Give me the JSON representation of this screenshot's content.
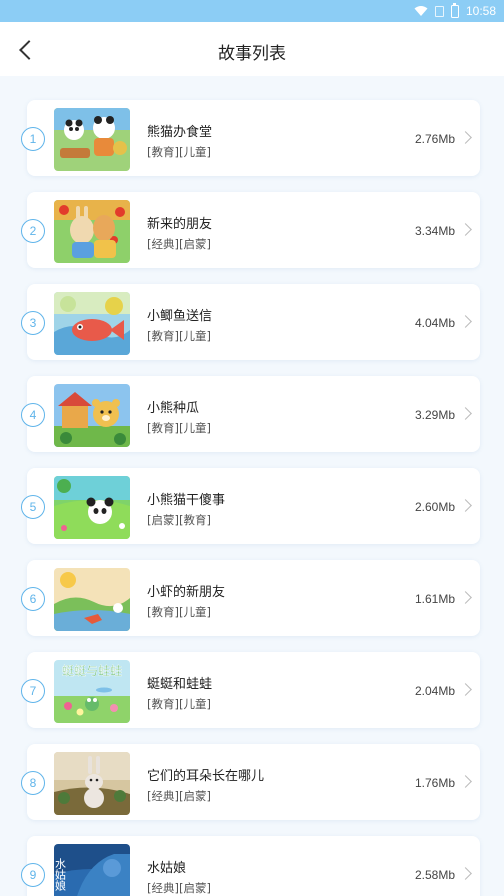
{
  "status_bar": {
    "time": "10:58"
  },
  "header": {
    "title": "故事列表"
  },
  "stories": [
    {
      "index": "1",
      "name": "熊猫办食堂",
      "tags": "[教育][儿童]",
      "size": "2.76Mb"
    },
    {
      "index": "2",
      "name": "新来的朋友",
      "tags": "[经典][启蒙]",
      "size": "3.34Mb"
    },
    {
      "index": "3",
      "name": "小鲫鱼送信",
      "tags": "[教育][儿童]",
      "size": "4.04Mb"
    },
    {
      "index": "4",
      "name": "小熊种瓜",
      "tags": "[教育][儿童]",
      "size": "3.29Mb"
    },
    {
      "index": "5",
      "name": "小熊猫干傻事",
      "tags": "[启蒙][教育]",
      "size": "2.60Mb"
    },
    {
      "index": "6",
      "name": "小虾的新朋友",
      "tags": "[教育][儿童]",
      "size": "1.61Mb"
    },
    {
      "index": "7",
      "name": "蜓蜓和蛙蛙",
      "tags": "[教育][儿童]",
      "size": "2.04Mb",
      "thumb_text": "蜓蜓与蛙蛙"
    },
    {
      "index": "8",
      "name": "它们的耳朵长在哪儿",
      "tags": "[经典][启蒙]",
      "size": "1.76Mb"
    },
    {
      "index": "9",
      "name": "水姑娘",
      "tags": "[经典][启蒙]",
      "size": "2.58Mb",
      "thumb_text": "水姑娘"
    }
  ],
  "colors": {
    "status_bar": "#8ccdf5",
    "accent": "#5fb4ea",
    "background": "#f3f8fd"
  }
}
